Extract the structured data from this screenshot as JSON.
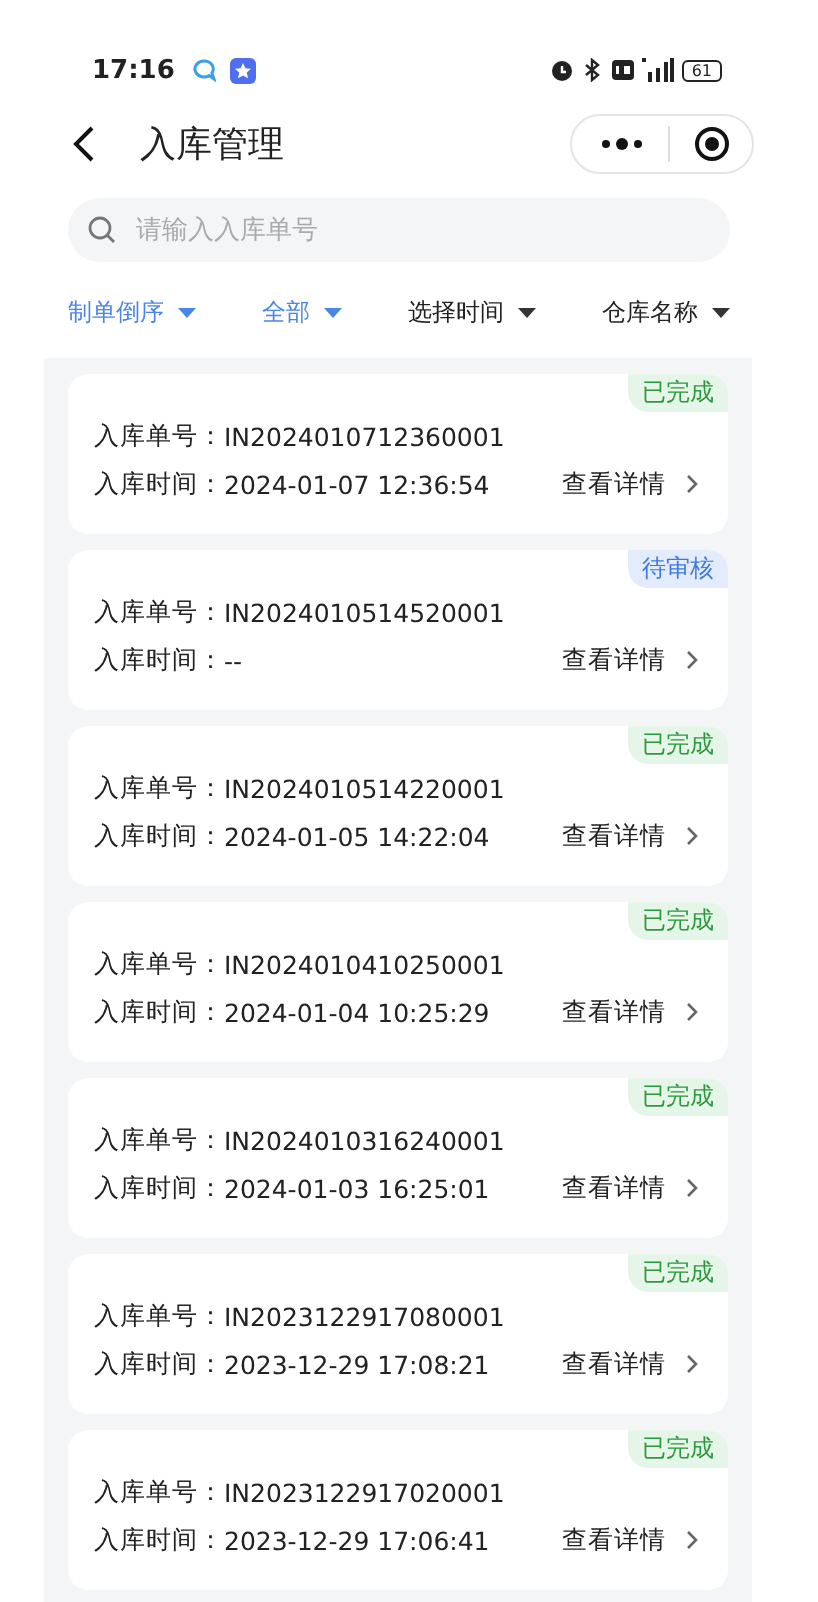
{
  "status_bar": {
    "time": "17:16",
    "battery": "61"
  },
  "header": {
    "title": "入库管理"
  },
  "search": {
    "placeholder": "请输入入库单号"
  },
  "filters": [
    {
      "label": "制单倒序",
      "active": true
    },
    {
      "label": "全部",
      "active": true
    },
    {
      "label": "选择时间",
      "active": false
    },
    {
      "label": "仓库名称",
      "active": false
    }
  ],
  "orders": [
    {
      "status": "已完成",
      "kind": "done",
      "number_label": "入库单号：",
      "number": "IN2024010712360001",
      "time_label": "入库时间：",
      "time": "2024-01-07 12:36:54",
      "link": "查看详情"
    },
    {
      "status": "待审核",
      "kind": "pending",
      "number_label": "入库单号：",
      "number": "IN2024010514520001",
      "time_label": "入库时间：",
      "time": "--",
      "link": "查看详情"
    },
    {
      "status": "已完成",
      "kind": "done",
      "number_label": "入库单号：",
      "number": "IN2024010514220001",
      "time_label": "入库时间：",
      "time": "2024-01-05 14:22:04",
      "link": "查看详情"
    },
    {
      "status": "已完成",
      "kind": "done",
      "number_label": "入库单号：",
      "number": "IN2024010410250001",
      "time_label": "入库时间：",
      "time": "2024-01-04 10:25:29",
      "link": "查看详情"
    },
    {
      "status": "已完成",
      "kind": "done",
      "number_label": "入库单号：",
      "number": "IN2024010316240001",
      "time_label": "入库时间：",
      "time": "2024-01-03 16:25:01",
      "link": "查看详情"
    },
    {
      "status": "已完成",
      "kind": "done",
      "number_label": "入库单号：",
      "number": "IN2023122917080001",
      "time_label": "入库时间：",
      "time": "2023-12-29 17:08:21",
      "link": "查看详情"
    },
    {
      "status": "已完成",
      "kind": "done",
      "number_label": "入库单号：",
      "number": "IN2023122917020001",
      "time_label": "入库时间：",
      "time": "2023-12-29 17:06:41",
      "link": "查看详情"
    }
  ]
}
